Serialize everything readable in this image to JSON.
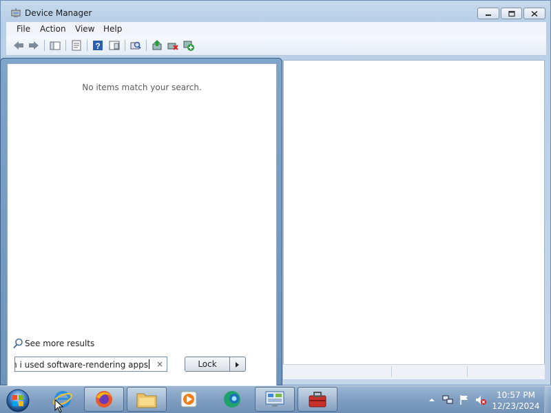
{
  "window": {
    "title": "Device Manager",
    "icon": "device-manager-icon",
    "controls": [
      "minimize-icon",
      "maximize-icon",
      "close-icon"
    ]
  },
  "menu": {
    "items": [
      "File",
      "Action",
      "View",
      "Help"
    ]
  },
  "toolbar": {
    "buttons": [
      "back-icon",
      "forward-icon",
      "show-hide-console-tree-icon",
      "properties-icon",
      "help-icon",
      "view-pane-icon",
      "scan-hardware-icon",
      "update-driver-icon",
      "uninstall-icon",
      "enable-device-icon"
    ]
  },
  "start_menu": {
    "no_results": "No items match your search.",
    "see_more": "See more results",
    "search_value": "when i used software-rendering apps",
    "search_clear": "×",
    "lock_label": "Lock"
  },
  "taskbar": {
    "start": "windows-start-orb",
    "items": [
      "internet-explorer-icon",
      "firefox-icon",
      "file-explorer-icon",
      "media-player-icon",
      "edge-icon",
      "control-panel-icon",
      "toolbox-icon"
    ],
    "tray": [
      "show-hidden-icons-icon",
      "network-icon",
      "action-center-flag-icon",
      "volume-muted-icon"
    ],
    "time": "10:57 PM",
    "date": "12/23/2024"
  }
}
